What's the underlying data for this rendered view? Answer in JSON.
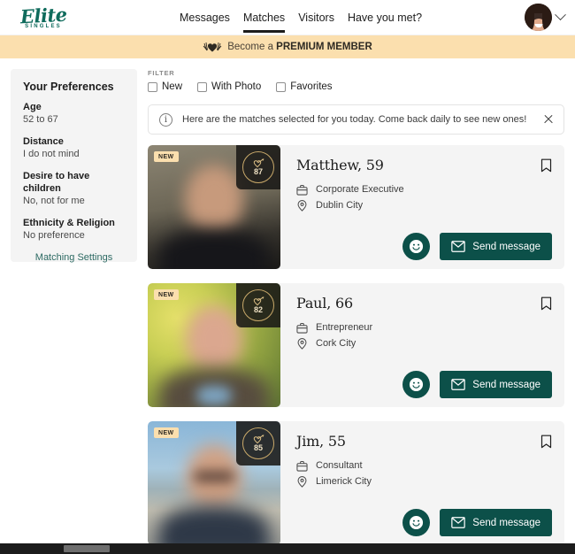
{
  "header": {
    "logo_word": "Elite",
    "logo_sub": "SINGLES",
    "nav": [
      {
        "label": "Messages",
        "active": false
      },
      {
        "label": "Matches",
        "active": true
      },
      {
        "label": "Visitors",
        "active": false
      },
      {
        "label": "Have you met?",
        "active": false
      }
    ],
    "account_icon": "avatar",
    "chevron_icon": "chevron-down-icon"
  },
  "premium_banner": {
    "icon": "heart-wreath-icon",
    "text_prefix": "Become a ",
    "text_strong": "PREMIUM MEMBER"
  },
  "sidebar": {
    "title": "Your Preferences",
    "preferences": [
      {
        "label": "Age",
        "value": "52 to 67"
      },
      {
        "label": "Distance",
        "value": "I do not mind"
      },
      {
        "label": "Desire to have children",
        "value": "No, not for me"
      },
      {
        "label": "Ethnicity & Religion",
        "value": "No preference"
      }
    ],
    "matching_settings_link": "Matching Settings"
  },
  "filter": {
    "label": "FILTER",
    "options": [
      {
        "label": "New",
        "checked": false
      },
      {
        "label": "With Photo",
        "checked": false
      },
      {
        "label": "Favorites",
        "checked": false
      }
    ]
  },
  "info_banner": {
    "icon": "info-icon",
    "text": "Here are the matches selected for you today. Come back daily to see new ones!",
    "close_icon": "close-icon"
  },
  "matches": [
    {
      "name": "Matthew, 59",
      "occupation": "Corporate Executive",
      "location": "Dublin City",
      "score": "87",
      "new_badge": "NEW",
      "send_label": "Send message"
    },
    {
      "name": "Paul, 66",
      "occupation": "Entrepreneur",
      "location": "Cork City",
      "score": "82",
      "new_badge": "NEW",
      "send_label": "Send message"
    },
    {
      "name": "Jim, 55",
      "occupation": "Consultant",
      "location": "Limerick City",
      "score": "85",
      "new_badge": "NEW",
      "send_label": "Send message"
    }
  ],
  "colors": {
    "brand_teal": "#0f6b5c",
    "button_teal": "#0c5049",
    "premium_gold": "#fbdfae",
    "badge_gold": "#c9a96a",
    "card_bg": "#f4f4f4"
  }
}
